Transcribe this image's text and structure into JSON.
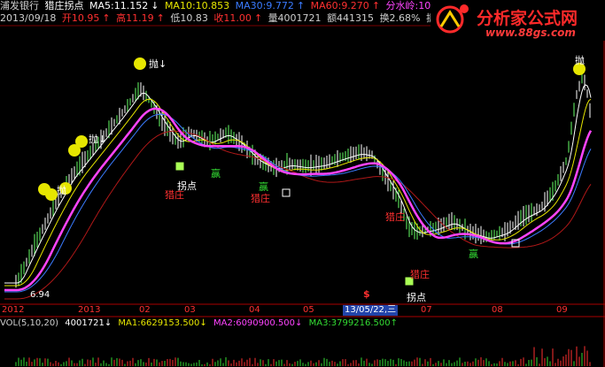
{
  "header": {
    "stock_name": "浦发银行",
    "indicator_name": "猎庄拐点",
    "ma5": "MA5:11.152",
    "ma10": "MA10:10.853",
    "ma30": "MA30:9.772",
    "ma60": "MA60:9.270",
    "extra": "分水岭:10.153",
    "date": "2013/09/18",
    "open": "开10.95",
    "high": "高11.19",
    "low": "低10.83",
    "close": "收11.00",
    "volume": "量4001721",
    "amount": "额441315",
    "turnover": "换2.68%",
    "amplitude": "振3."
  },
  "logo": {
    "name": "分析家公式网",
    "url": "www.88gs.com"
  },
  "chart": {
    "labels": {
      "throw": "抛",
      "hunt": "猎庄",
      "turn": "拐点",
      "win": "赢",
      "low_value": "6.94",
      "dollar": "$"
    }
  },
  "axis": {
    "ticks": [
      "2012",
      "2013",
      "02",
      "03",
      "04",
      "05",
      "07",
      "08",
      "09"
    ],
    "cursor_date": "13/05/22,三"
  },
  "volume_panel": {
    "title": "VOL(5,10,20)",
    "vol": "4001721",
    "ma1": "MA1:6629153.500",
    "ma2": "MA2:6090900.500",
    "ma3": "MA3:3799216.500"
  },
  "colors": {
    "ma5": "#ffffff",
    "ma10": "#e6e600",
    "ma30": "#ff44ff",
    "ma60": "#3a7bff",
    "up": "#ff3030",
    "down": "#33dd33",
    "bg": "#000000"
  }
}
